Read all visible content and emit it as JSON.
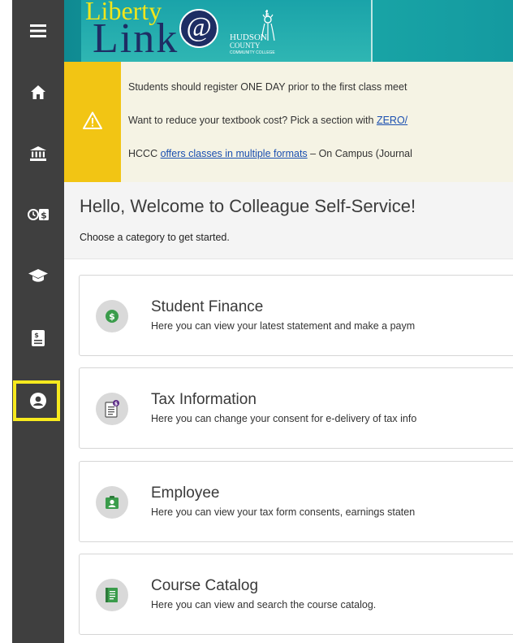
{
  "logo": {
    "word1": "Liberty",
    "word2": "Link",
    "at": "@",
    "school_line1": "HUDSON",
    "school_line2": "COUNTY",
    "school_line3": "COMMUNITY COLLEGE"
  },
  "sidebar": {
    "items": [
      {
        "name": "menu",
        "icon": "menu-icon"
      },
      {
        "name": "home",
        "icon": "home-icon"
      },
      {
        "name": "finance",
        "icon": "bank-icon"
      },
      {
        "name": "time-money",
        "icon": "clock-dollar-icon"
      },
      {
        "name": "academics",
        "icon": "graduation-cap-icon"
      },
      {
        "name": "tax",
        "icon": "tax-document-icon"
      },
      {
        "name": "user",
        "icon": "user-circle-icon"
      }
    ],
    "highlight_color": "#f7ea1e"
  },
  "alert": {
    "line1": "Students should register ONE DAY prior to the first class meet",
    "line2_prefix": "Want to reduce your textbook cost? Pick a section with ",
    "line2_link": "ZERO/",
    "line3_prefix": "HCCC ",
    "line3_link": "offers classes in multiple formats",
    "line3_suffix": " – On Campus (Journal"
  },
  "welcome": {
    "title": "Hello, Welcome to Colleague Self-Service!",
    "subtitle": "Choose a category to get started."
  },
  "cards": [
    {
      "title": "Student Finance",
      "desc": "Here you can view your latest statement and make a paym",
      "icon": "dollar-circle-icon"
    },
    {
      "title": "Tax Information",
      "desc": "Here you can change your consent for e-delivery of tax info",
      "icon": "tax-form-icon"
    },
    {
      "title": "Employee",
      "desc": "Here you can view your tax form consents, earnings staten",
      "icon": "employee-badge-icon"
    },
    {
      "title": "Course Catalog",
      "desc": "Here you can view and search the course catalog.",
      "icon": "catalog-book-icon"
    }
  ],
  "colors": {
    "sidebar": "#3f3f3f",
    "banner": "#1aa8a8",
    "alert_strip": "#f2c514",
    "alert_bg": "#f5f3e4",
    "link": "#1a4fb0",
    "card_icon_green": "#3a9c4b"
  }
}
